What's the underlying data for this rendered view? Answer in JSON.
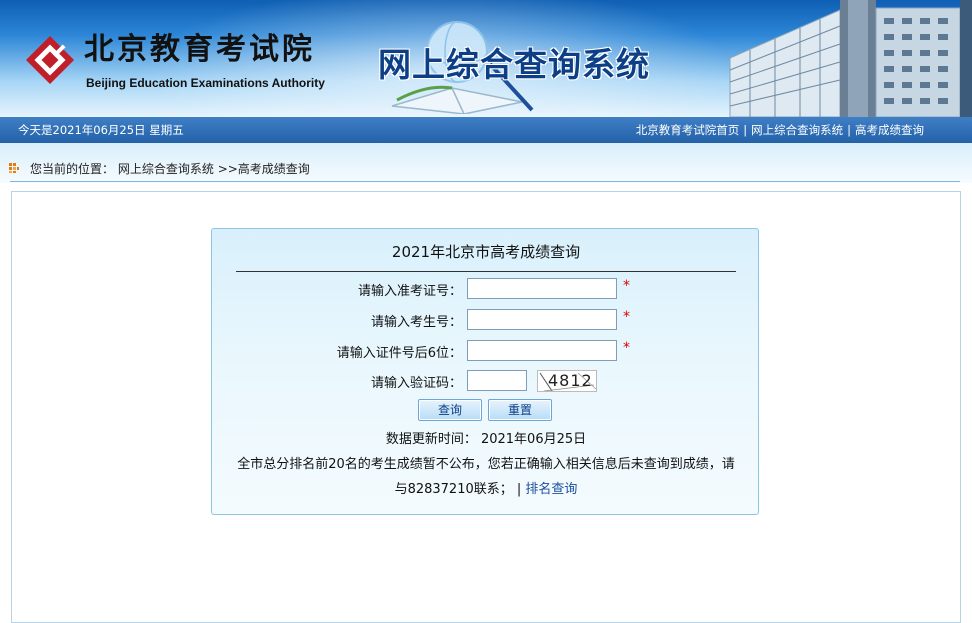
{
  "header": {
    "logo_cn": "北京教育考试院",
    "logo_en": "Beijing Education Examinations Authority",
    "system_title": "网上综合查询系统"
  },
  "infobar": {
    "date_text": "今天是2021年06月25日  星期五",
    "links": [
      {
        "label": "北京教育考试院首页"
      },
      {
        "label": "网上综合查询系统"
      },
      {
        "label": "高考成绩查询"
      }
    ],
    "separator": "|"
  },
  "breadcrumb": {
    "prefix": "您当前的位置：",
    "root": "网上综合查询系统",
    "arrow": ">>",
    "current": "高考成绩查询"
  },
  "panel": {
    "title": "2021年北京市高考成绩查询",
    "fields": [
      {
        "label": "请输入准考证号：",
        "value": "",
        "required": "*"
      },
      {
        "label": "请输入考生号：",
        "value": "",
        "required": "*"
      },
      {
        "label": "请输入证件号后6位：",
        "value": "",
        "required": "*"
      },
      {
        "label": "请输入验证码：",
        "value": ""
      }
    ],
    "captcha_text": "4812",
    "query_button": "查询",
    "reset_button": "重置",
    "update_line": "数据更新时间： 2021年06月25日",
    "notice_text": "全市总分排名前20名的考生成绩暂不公布，您若正确输入相关信息后未查询到成绩，请与82837210联系；",
    "notice_sep": "|",
    "rank_link": "排名查询"
  },
  "colors": {
    "accent": "#2361a8",
    "required": "#e00000",
    "link": "#1a4f9e"
  }
}
